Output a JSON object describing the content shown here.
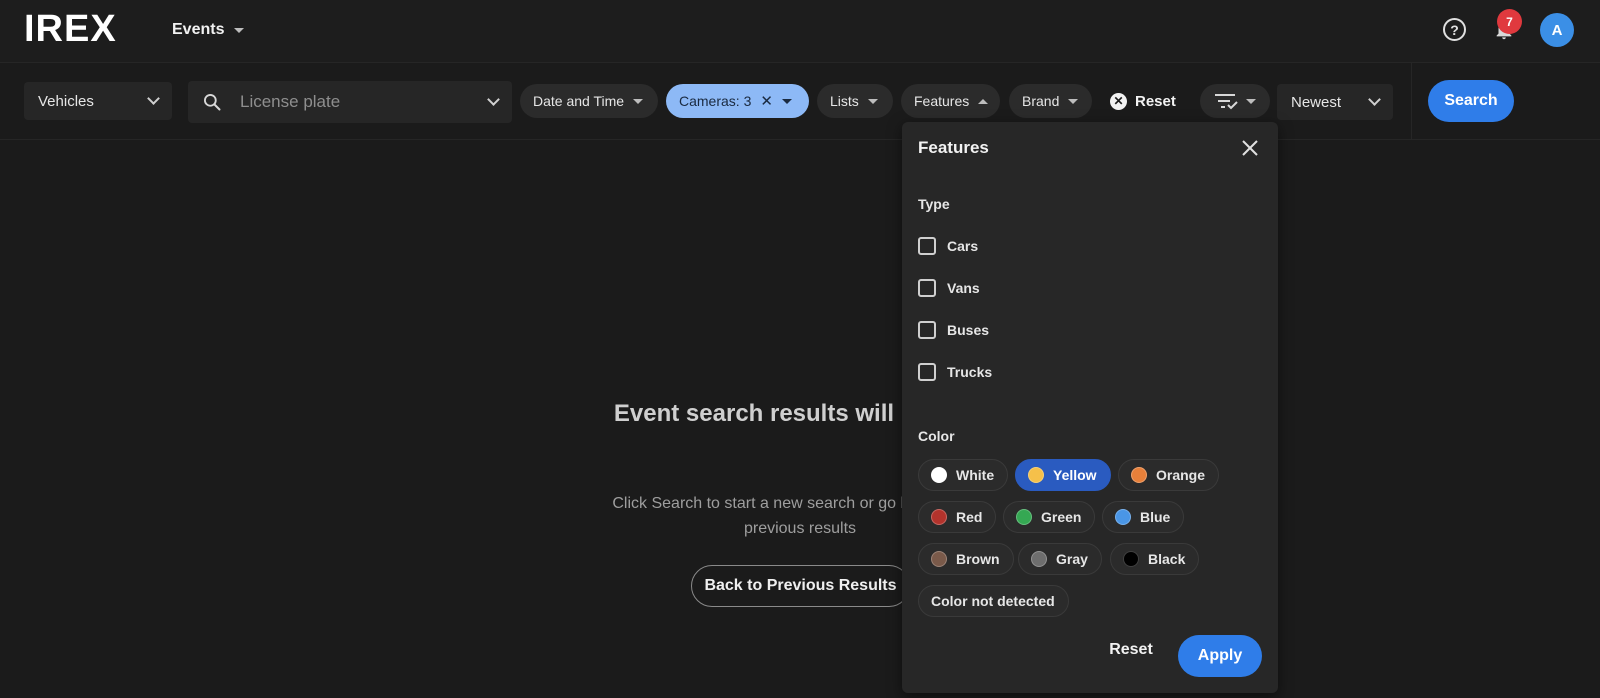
{
  "header": {
    "logo": "IREX",
    "section": "Events",
    "notification_count": "7",
    "avatar_initial": "A"
  },
  "filters": {
    "object_type": "Vehicles",
    "plate_placeholder": "License plate",
    "chips": {
      "date_time": "Date and Time",
      "cameras": "Cameras: 3",
      "lists": "Lists",
      "features": "Features",
      "brand": "Brand"
    },
    "reset": "Reset",
    "sort": "Newest",
    "search": "Search"
  },
  "empty_state": {
    "title": "Event search results will be here",
    "description": "Click Search to start a new search or go back to your previous results",
    "back_button": "Back to Previous Results"
  },
  "features_panel": {
    "title": "Features",
    "type_label": "Type",
    "types": [
      {
        "label": "Cars",
        "checked": false
      },
      {
        "label": "Vans",
        "checked": false
      },
      {
        "label": "Buses",
        "checked": false
      },
      {
        "label": "Trucks",
        "checked": false
      }
    ],
    "color_label": "Color",
    "colors": [
      {
        "label": "White",
        "swatch": "#ffffff",
        "selected": false
      },
      {
        "label": "Yellow",
        "swatch": "#f5c04a",
        "selected": true
      },
      {
        "label": "Orange",
        "swatch": "#e8803a",
        "selected": false
      },
      {
        "label": "Red",
        "swatch": "#b3332c",
        "selected": false
      },
      {
        "label": "Green",
        "swatch": "#35a853",
        "selected": false
      },
      {
        "label": "Blue",
        "swatch": "#4a96e6",
        "selected": false
      },
      {
        "label": "Brown",
        "swatch": "#7a5a4a",
        "selected": false
      },
      {
        "label": "Gray",
        "swatch": "#6e6e6e",
        "selected": false
      },
      {
        "label": "Black",
        "swatch": "#000000",
        "selected": false
      },
      {
        "label": "Color not detected",
        "swatch": "",
        "selected": false
      }
    ],
    "reset": "Reset",
    "apply": "Apply"
  },
  "colors": {
    "accent": "#2f7de9",
    "active_chip": "#8db9f6",
    "background": "#1b1b1b",
    "badge": "#e0393e"
  }
}
